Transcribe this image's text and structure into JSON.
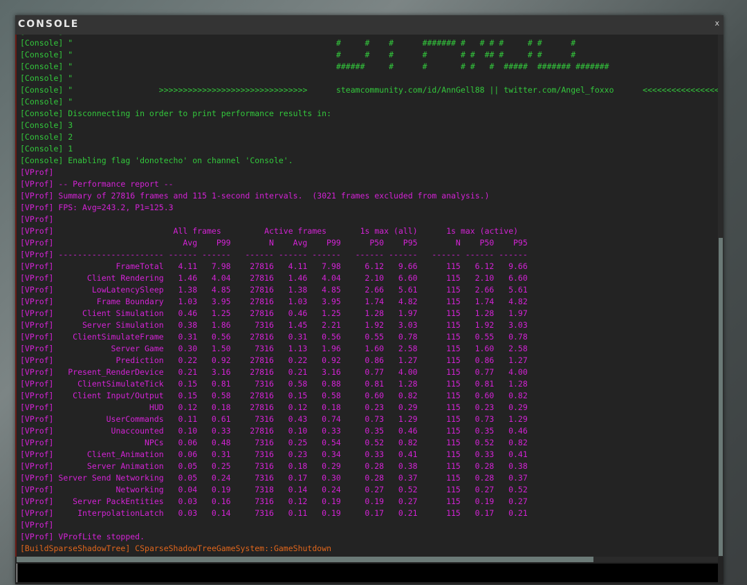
{
  "window": {
    "title": "CONSOLE",
    "close_label": "x"
  },
  "colors": {
    "console": "#33c83c",
    "vprof": "#d423d6",
    "shadow": "#e0661c",
    "background": "#232323"
  },
  "lines": [
    {
      "prefix": "[Console]",
      "color": "green",
      "text": " \"",
      "art": "######     #      #      # #  # #  #### #####   #"
    },
    {
      "prefix": "[Console]",
      "color": "green",
      "text": " \"",
      "art": "#     #    #      ####### #   # # #     # #      #"
    },
    {
      "prefix": "[Console]",
      "color": "green",
      "text": " \"",
      "art": "#     #    #      #       # #  ## #     # #      #"
    },
    {
      "prefix": "[Console]",
      "color": "green",
      "text": " \"",
      "art": "######     #      #       # #   #  #####  ####### #######"
    },
    {
      "prefix": "[Console]",
      "color": "green",
      "text": " \""
    },
    {
      "prefix": "[Console]",
      "color": "green",
      "text": " \"",
      "arrows": ">>>>>>>>>>>>>>>>>>>>>>>>>>>>>>>",
      "art": "steamcommunity.com/id/AnnGell88 || twitter.com/Angel_foxxo",
      "back_arrows": "<<<<<<<<<<<<<<<<<<<<<<<<"
    },
    {
      "prefix": "[Console]",
      "color": "green",
      "text": " \""
    },
    {
      "prefix": "[Console]",
      "color": "green",
      "text": " Disconnecting in order to print performance results in:"
    },
    {
      "prefix": "[Console]",
      "color": "green",
      "text": " 3"
    },
    {
      "prefix": "[Console]",
      "color": "green",
      "text": " 2"
    },
    {
      "prefix": "[Console]",
      "color": "green",
      "text": " 1"
    },
    {
      "prefix": "[Console]",
      "color": "green",
      "text": " Enabling flag 'donotecho' on channel 'Console'."
    },
    {
      "prefix": "[VProf]",
      "color": "mag",
      "text": ""
    },
    {
      "prefix": "[VProf]",
      "color": "mag",
      "text": " -- Performance report --"
    },
    {
      "prefix": "[VProf]",
      "color": "mag",
      "text": " Summary of 27816 frames and 115 1-second intervals.  (3021 frames excluded from analysis.)"
    },
    {
      "prefix": "[VProf]",
      "color": "mag",
      "text": " FPS: Avg=243.2, P1=125.3"
    },
    {
      "prefix": "[VProf]",
      "color": "mag",
      "text": ""
    }
  ],
  "table": {
    "prefix": "[VProf]",
    "groups": [
      "All frames",
      "Active frames",
      "1s max (all)",
      "1s max (active)"
    ],
    "columns": [
      "Avg",
      "P99",
      "N",
      "Avg",
      "P99",
      "P50",
      "P95",
      "N",
      "P50",
      "P95"
    ],
    "rows": [
      {
        "name": "FrameTotal",
        "values": [
          "4.11",
          "7.98",
          "27816",
          "4.11",
          "7.98",
          "6.12",
          "9.66",
          "115",
          "6.12",
          "9.66"
        ]
      },
      {
        "name": "Client Rendering",
        "values": [
          "1.46",
          "4.04",
          "27816",
          "1.46",
          "4.04",
          "2.10",
          "6.60",
          "115",
          "2.10",
          "6.60"
        ]
      },
      {
        "name": "LowLatencySleep",
        "values": [
          "1.38",
          "4.85",
          "27816",
          "1.38",
          "4.85",
          "2.66",
          "5.61",
          "115",
          "2.66",
          "5.61"
        ]
      },
      {
        "name": "Frame Boundary",
        "values": [
          "1.03",
          "3.95",
          "27816",
          "1.03",
          "3.95",
          "1.74",
          "4.82",
          "115",
          "1.74",
          "4.82"
        ]
      },
      {
        "name": "Client Simulation",
        "values": [
          "0.46",
          "1.25",
          "27816",
          "0.46",
          "1.25",
          "1.28",
          "1.97",
          "115",
          "1.28",
          "1.97"
        ]
      },
      {
        "name": "Server Simulation",
        "values": [
          "0.38",
          "1.86",
          "7316",
          "1.45",
          "2.21",
          "1.92",
          "3.03",
          "115",
          "1.92",
          "3.03"
        ]
      },
      {
        "name": "ClientSimulateFrame",
        "values": [
          "0.31",
          "0.56",
          "27816",
          "0.31",
          "0.56",
          "0.55",
          "0.78",
          "115",
          "0.55",
          "0.78"
        ]
      },
      {
        "name": "Server Game",
        "values": [
          "0.30",
          "1.50",
          "7316",
          "1.13",
          "1.96",
          "1.60",
          "2.58",
          "115",
          "1.60",
          "2.58"
        ]
      },
      {
        "name": "Prediction",
        "values": [
          "0.22",
          "0.92",
          "27816",
          "0.22",
          "0.92",
          "0.86",
          "1.27",
          "115",
          "0.86",
          "1.27"
        ]
      },
      {
        "name": "Present_RenderDevice",
        "values": [
          "0.21",
          "3.16",
          "27816",
          "0.21",
          "3.16",
          "0.77",
          "4.00",
          "115",
          "0.77",
          "4.00"
        ]
      },
      {
        "name": "ClientSimulateTick",
        "values": [
          "0.15",
          "0.81",
          "7316",
          "0.58",
          "0.88",
          "0.81",
          "1.28",
          "115",
          "0.81",
          "1.28"
        ]
      },
      {
        "name": "Client Input/Output",
        "values": [
          "0.15",
          "0.58",
          "27816",
          "0.15",
          "0.58",
          "0.60",
          "0.82",
          "115",
          "0.60",
          "0.82"
        ]
      },
      {
        "name": "HUD",
        "values": [
          "0.12",
          "0.18",
          "27816",
          "0.12",
          "0.18",
          "0.23",
          "0.29",
          "115",
          "0.23",
          "0.29"
        ]
      },
      {
        "name": "UserCommands",
        "values": [
          "0.11",
          "0.61",
          "7316",
          "0.43",
          "0.74",
          "0.73",
          "1.29",
          "115",
          "0.73",
          "1.29"
        ]
      },
      {
        "name": "Unaccounted",
        "values": [
          "0.10",
          "0.33",
          "27816",
          "0.10",
          "0.33",
          "0.35",
          "0.46",
          "115",
          "0.35",
          "0.46"
        ]
      },
      {
        "name": "NPCs",
        "values": [
          "0.06",
          "0.48",
          "7316",
          "0.25",
          "0.54",
          "0.52",
          "0.82",
          "115",
          "0.52",
          "0.82"
        ]
      },
      {
        "name": "Client_Animation",
        "values": [
          "0.06",
          "0.31",
          "7316",
          "0.23",
          "0.34",
          "0.33",
          "0.41",
          "115",
          "0.33",
          "0.41"
        ]
      },
      {
        "name": "Server Animation",
        "values": [
          "0.05",
          "0.25",
          "7316",
          "0.18",
          "0.29",
          "0.28",
          "0.38",
          "115",
          "0.28",
          "0.38"
        ]
      },
      {
        "name": "Server Send Networking",
        "values": [
          "0.05",
          "0.24",
          "7316",
          "0.17",
          "0.30",
          "0.28",
          "0.37",
          "115",
          "0.28",
          "0.37"
        ]
      },
      {
        "name": "Networking",
        "values": [
          "0.04",
          "0.19",
          "7318",
          "0.14",
          "0.24",
          "0.27",
          "0.52",
          "115",
          "0.27",
          "0.52"
        ]
      },
      {
        "name": "Server PackEntities",
        "values": [
          "0.03",
          "0.16",
          "7316",
          "0.12",
          "0.19",
          "0.19",
          "0.27",
          "115",
          "0.19",
          "0.27"
        ]
      },
      {
        "name": "InterpolationLatch",
        "values": [
          "0.03",
          "0.14",
          "7316",
          "0.11",
          "0.19",
          "0.17",
          "0.21",
          "115",
          "0.17",
          "0.21"
        ]
      }
    ]
  },
  "after_lines": [
    {
      "prefix": "[VProf]",
      "color": "mag",
      "text": ""
    },
    {
      "prefix": "[VProf]",
      "color": "mag",
      "text": " VProfLite stopped."
    },
    {
      "prefix": "[BuildSparseShadowTree]",
      "color": "orange",
      "text": " CSparseShadowTreeGameSystem::GameShutdown"
    }
  ],
  "input": {
    "value": "",
    "placeholder": ""
  }
}
